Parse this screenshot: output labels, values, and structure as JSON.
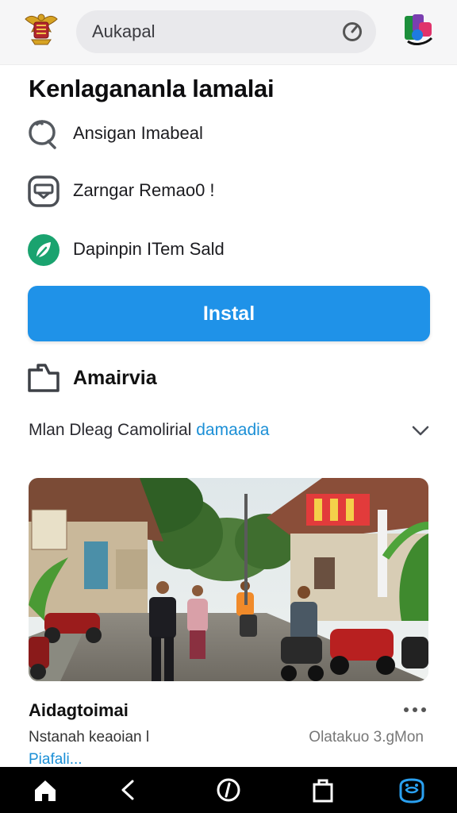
{
  "header": {
    "search_text": "Aukapal",
    "left_logo_icon": "emblem-icon",
    "right_logo_icon": "app-logo-icon"
  },
  "title": "Kenlagananla lamalai",
  "features": [
    {
      "icon": "search-icon",
      "label": "Ansigan Imabeal"
    },
    {
      "icon": "shield-icon",
      "label": "Zarngar Remao0 !"
    },
    {
      "icon": "leaf-icon",
      "label": "Dapinpin ITem Sald"
    }
  ],
  "install_button": {
    "label": "Instal"
  },
  "about": {
    "icon": "folder-icon",
    "label": "Amairvia"
  },
  "description": {
    "text": "Mlan Dleag Camolirial ",
    "link": "damaadia"
  },
  "card": {
    "title": "Aidagtoimai",
    "subtitle": "Nstanah keaoian l",
    "meta": "Olatakuo 3.gMon",
    "link": "Piafali..."
  },
  "navbar": {
    "items": [
      "home-icon",
      "back-icon",
      "compass-icon",
      "bag-icon",
      "game-icon"
    ]
  },
  "colors": {
    "accent": "#1f92e8",
    "link": "#1b8fd6",
    "leaf": "#1aa36f",
    "nav_bg": "#000000"
  }
}
